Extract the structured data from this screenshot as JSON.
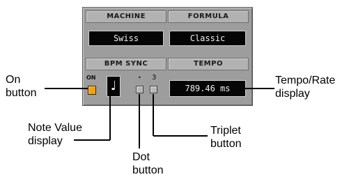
{
  "panel": {
    "machine_header": "MACHINE",
    "formula_header": "FORMULA",
    "machine_value": "Swiss",
    "formula_value": "Classic",
    "bpm_sync_header": "BPM SYNC",
    "tempo_header": "TEMPO",
    "on_label": "ON",
    "note_symbol": "♩",
    "dot_mark": "•",
    "triplet_mark": "3",
    "tempo_value": "789.46 ms"
  },
  "callouts": {
    "on_button": "On button",
    "note_value": "Note Value display",
    "dot_button": "Dot button",
    "triplet_button": "Triplet button",
    "tempo_rate": "Tempo/Rate display"
  },
  "colors": {
    "led": "#f0a010",
    "display_bg": "#050505",
    "panel_bg": "#9d9d9d"
  }
}
